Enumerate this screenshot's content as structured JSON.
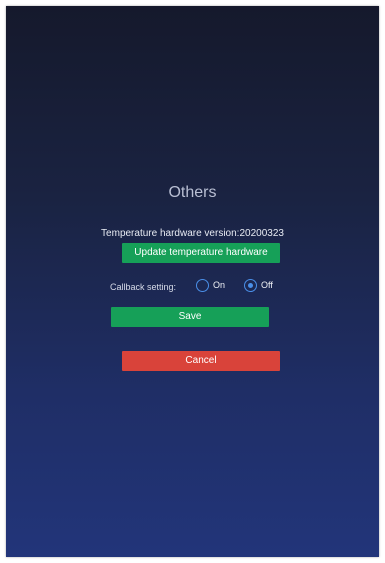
{
  "dialog": {
    "title": "Others",
    "version_text": "Temperature hardware version:20200323",
    "update_button": "Update temperature hardware",
    "callback": {
      "label": "Callback setting:",
      "options": [
        {
          "label": "On",
          "selected": false
        },
        {
          "label": "Off",
          "selected": true
        }
      ]
    },
    "save_button": "Save",
    "cancel_button": "Cancel"
  },
  "colors": {
    "background_top": "#15192c",
    "background_bottom": "#22357a",
    "primary_button": "#16a058",
    "cancel_button": "#d9433a",
    "radio_accent": "#4a8fe8"
  }
}
